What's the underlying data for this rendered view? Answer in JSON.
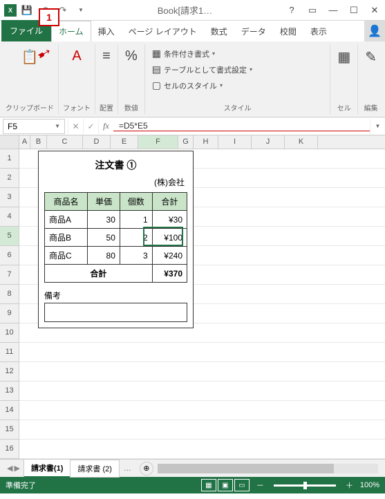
{
  "callout": "1",
  "title": "Book[請求1…",
  "tabs": {
    "file": "ファイル",
    "home": "ホーム",
    "insert": "挿入",
    "layout": "ページ レイアウト",
    "formulas": "数式",
    "data": "データ",
    "review": "校閲",
    "view": "表示"
  },
  "ribbon": {
    "clipboard": "クリップボード",
    "font": "フォント",
    "align": "配置",
    "number": "数値",
    "cond_fmt": "条件付き書式",
    "as_table": "テーブルとして書式設定",
    "cell_styles": "セルのスタイル",
    "styles": "スタイル",
    "cell": "セル",
    "edit": "編集"
  },
  "namebox": "F5",
  "formula": "=D5*E5",
  "columns": [
    "A",
    "B",
    "C",
    "D",
    "E",
    "F",
    "G",
    "H",
    "I",
    "J",
    "K"
  ],
  "row_count": 16,
  "active_row": 5,
  "active_col": "F",
  "doc": {
    "title": "注文書 ①",
    "company": "(株)会社",
    "headers": {
      "name": "商品名",
      "price": "単価",
      "qty": "個数",
      "total": "合計"
    },
    "rows": [
      {
        "name": "商品A",
        "price": "30",
        "qty": "1",
        "total": "¥30"
      },
      {
        "name": "商品B",
        "price": "50",
        "qty": "2",
        "total": "¥100"
      },
      {
        "name": "商品C",
        "price": "80",
        "qty": "3",
        "total": "¥240"
      }
    ],
    "total_label": "合計",
    "total_value": "¥370",
    "notes_label": "備考"
  },
  "sheets": {
    "s1": "請求書(1)",
    "s2": "請求書 (2)",
    "more": "…"
  },
  "status": {
    "ready": "準備完了",
    "zoom": "100%"
  },
  "symbols": {
    "add": "＋",
    "minus": "－",
    "expand": "⤢"
  }
}
